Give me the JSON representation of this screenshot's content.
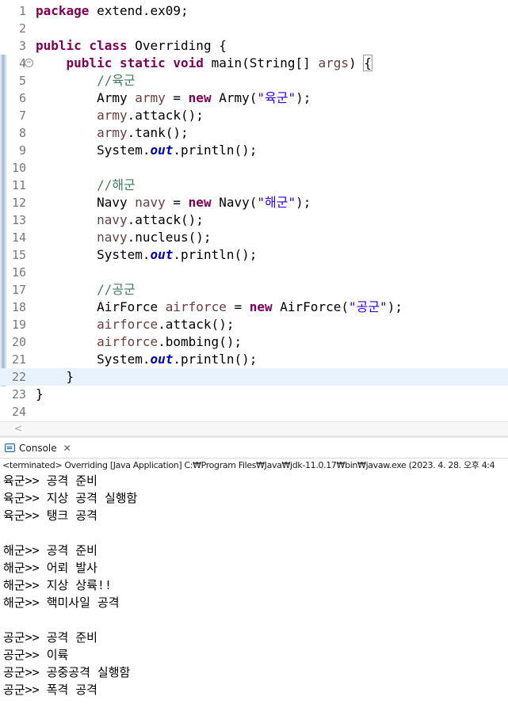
{
  "editor": {
    "lines": [
      {
        "n": "1"
      },
      {
        "n": "2"
      },
      {
        "n": "3"
      },
      {
        "n": "4"
      },
      {
        "n": "5"
      },
      {
        "n": "6"
      },
      {
        "n": "7"
      },
      {
        "n": "8"
      },
      {
        "n": "9"
      },
      {
        "n": "10"
      },
      {
        "n": "11"
      },
      {
        "n": "12"
      },
      {
        "n": "13"
      },
      {
        "n": "14"
      },
      {
        "n": "15"
      },
      {
        "n": "16"
      },
      {
        "n": "17"
      },
      {
        "n": "18"
      },
      {
        "n": "19"
      },
      {
        "n": "20"
      },
      {
        "n": "21"
      },
      {
        "n": "22"
      },
      {
        "n": "23"
      },
      {
        "n": "24"
      }
    ],
    "t": {
      "package": "package",
      "pkg_name": " extend.ex09;",
      "public": "public",
      "class": "class",
      "class_name": " Overriding {",
      "static": "static",
      "void": "void",
      "main": " main(String[] ",
      "args": "args",
      "close_paren": ") ",
      "brace": "{",
      "c_army": "//육군",
      "army_type": "Army ",
      "army_var": "army",
      "eq": " = ",
      "new": "new",
      "army_ctor": " Army(",
      "army_str": "\"육군\"",
      "end": ");",
      "army_attack": ".attack();",
      "army_tank": ".tank();",
      "system": "System.",
      "out": "out",
      "println": ".println();",
      "c_navy": "//해군",
      "navy_type": "Navy ",
      "navy_var": "navy",
      "navy_ctor": " Navy(",
      "navy_str": "\"해군\"",
      "navy_attack": ".attack();",
      "navy_nucleus": ".nucleus();",
      "c_air": "//공군",
      "air_type": "AirForce ",
      "air_var": "airforce",
      "air_ctor": " AirForce(",
      "air_str": "\"공군\"",
      "air_attack": ".attack();",
      "air_bombing": ".bombing();",
      "close_method": "}",
      "close_class": "}"
    },
    "fold_marker": "−",
    "scroll_left_arrow": "<"
  },
  "console": {
    "tab_label": "Console",
    "tab_close": "✕",
    "status": "<terminated> Overriding [Java Application] C:₩Program Files₩Java₩jdk-11.0.17₩bin₩javaw.exe  (2023. 4. 28. 오후 4:4",
    "output": [
      "육군>> 공격 준비",
      "육군>> 지상 공격 실행함",
      "육군>> 탱크 공격",
      "",
      "해군>> 공격 준비",
      "해군>> 어뢰 발사",
      "해군>> 지상 상륙!!",
      "해군>> 핵미사일 공격",
      "",
      "공군>> 공격 준비",
      "공군>> 이륙",
      "공군>> 공중공격 실행함",
      "공군>> 폭격 공격"
    ]
  },
  "colors": {
    "keyword": "#7f0055",
    "comment": "#3f7f5f",
    "string": "#2a00ff",
    "local_var": "#6a3e3e",
    "static_field": "#0000c0",
    "current_line": "#e8f2fe"
  }
}
